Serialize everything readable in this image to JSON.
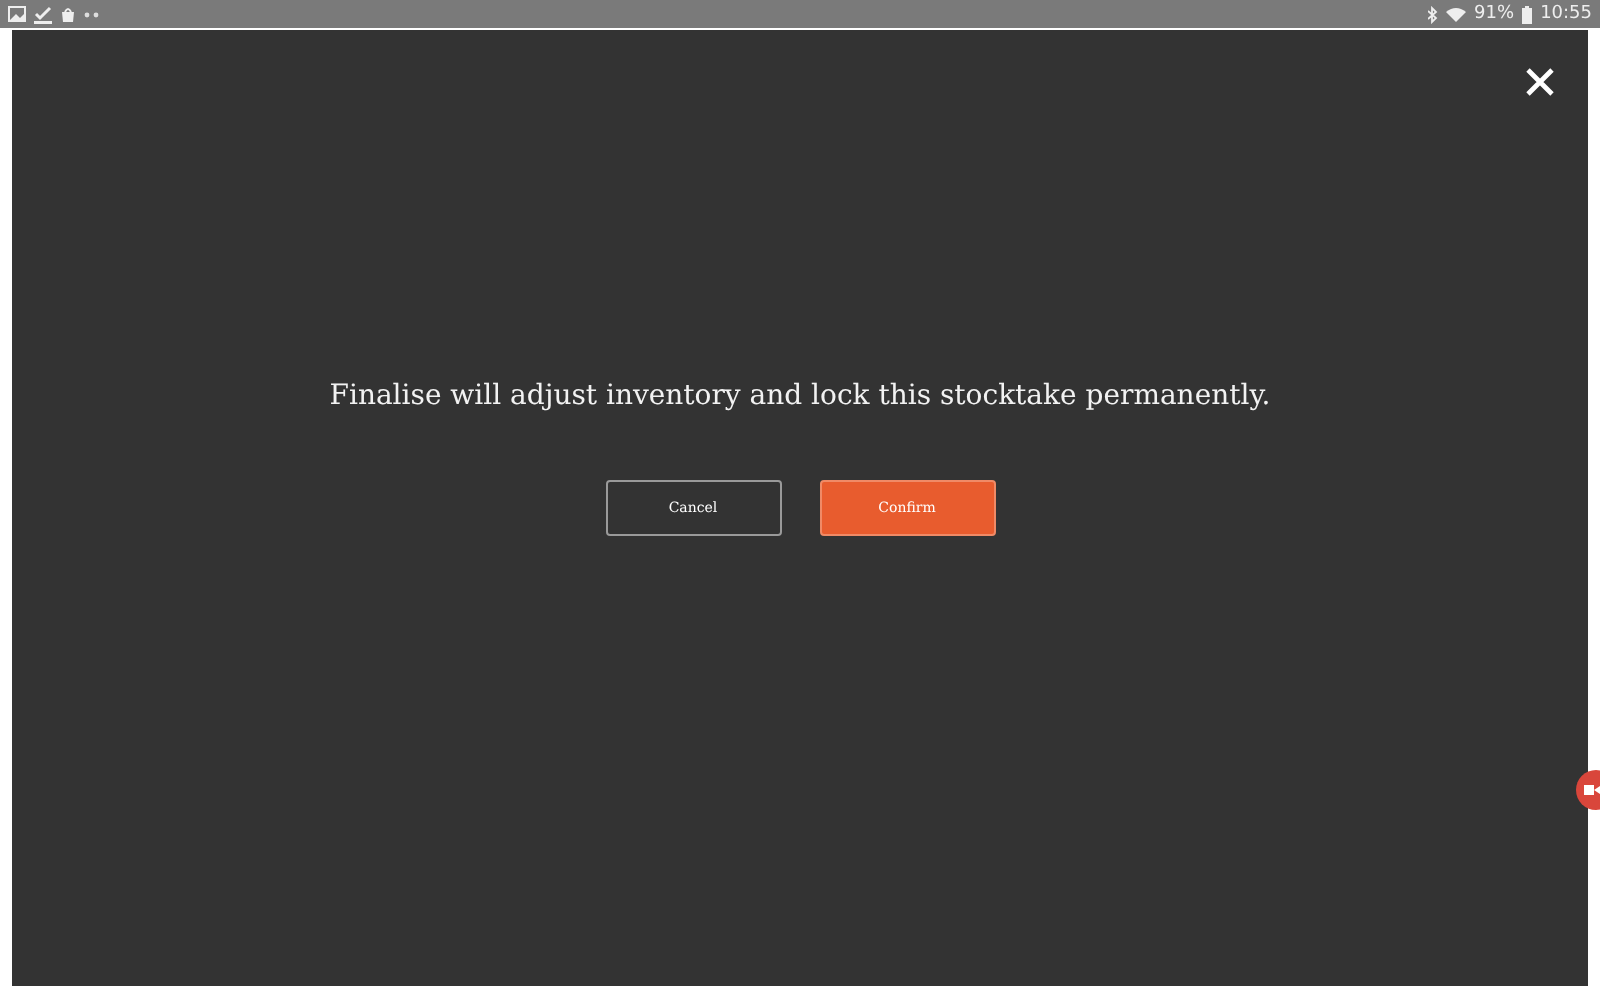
{
  "status_bar": {
    "battery": "91%",
    "time": "10:55"
  },
  "dialog": {
    "message": "Finalise will adjust inventory and lock this stocktake permanently.",
    "buttons": [
      {
        "label": "Cancel",
        "kind": "secondary"
      },
      {
        "label": "Confirm",
        "kind": "primary"
      }
    ]
  }
}
